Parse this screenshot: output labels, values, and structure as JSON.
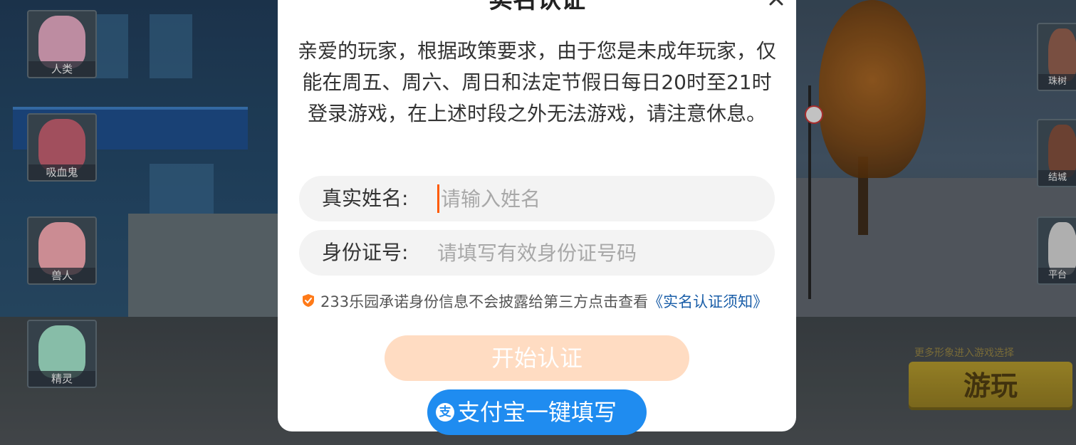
{
  "left_characters": [
    {
      "label": "人类",
      "icon": "human-avatar-icon",
      "color": "#d8a0b8"
    },
    {
      "label": "吸血鬼",
      "icon": "vampire-avatar-icon",
      "color": "#b85a6a"
    },
    {
      "label": "兽人",
      "icon": "beastfolk-avatar-icon",
      "color": "#e8a0a8"
    },
    {
      "label": "精灵",
      "icon": "elf-avatar-icon",
      "color": "#9ad8c0"
    }
  ],
  "right_characters": [
    {
      "label": "珠树",
      "icon": "avatar-icon"
    },
    {
      "label": "结城",
      "icon": "avatar-icon"
    },
    {
      "label": "平台",
      "icon": "avatar-icon"
    }
  ],
  "game": {
    "more_hint": "更多形象进入游戏选择",
    "play_label": "游玩"
  },
  "dialog": {
    "title": "实名认证",
    "close_icon": "close-icon",
    "notice": "亲爱的玩家，根据政策要求，由于您是未成年玩家，仅能在周五、周六、周日和法定节假日每日20时至21时登录游戏，在上述时段之外无法游戏，请注意休息。",
    "name_field": {
      "label": "真实姓名:",
      "placeholder": "请输入姓名",
      "value": ""
    },
    "id_field": {
      "label": "身份证号:",
      "placeholder": "请填写有效身份证号码",
      "value": ""
    },
    "promise_text": "233乐园承诺身份信息不会披露给第三方点击查看",
    "promise_link": "《实名认证须知》",
    "start_button": "开始认证",
    "alipay_button": "支付宝一键填写",
    "alipay_icon": "alipay-icon",
    "accent_color": "#1f8cf0",
    "start_color": "#ffdcc2",
    "cursor_color": "#ff5a00"
  }
}
